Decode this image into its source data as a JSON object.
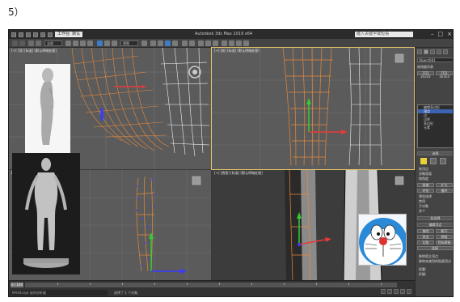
{
  "step_label": "5）",
  "app": {
    "title": "Autodesk 3ds Max 2019 x64",
    "project_field": "工作台: 默认",
    "search_placeholder": "键入关键字或短语",
    "window_controls": [
      "minimize-icon",
      "maximize-icon",
      "close-icon"
    ]
  },
  "toolbar": {
    "selection_filter": "全部",
    "reference_coord": "视图"
  },
  "viewports": {
    "top_left_label": "[+] [顶] [标准] [默认明暗处理]",
    "top_right_label": "[+] [前] [标准] [默认明暗处理]",
    "bottom_left_label": "[+] [左] [标准] [默认明暗处理]",
    "bottom_right_label": "[+] [透视] [标准] [默认明暗处理]"
  },
  "command_panel": {
    "object_name": "Object001",
    "modifier_list_label": "修改器列表",
    "quick_buttons": [
      "FFD 2x2x2",
      "FFD 3x3x3"
    ],
    "stack_items": [
      "编辑多边形",
      "顶点",
      "边",
      "边界",
      "多边形",
      "元素"
    ],
    "selected_stack_item": "顶点",
    "rollout_selection": "选择",
    "rows": [
      "按顶点",
      "忽略背面",
      "按角度",
      "收缩",
      "扩大",
      "环形",
      "循环",
      "预览选择",
      "禁用",
      "子对象",
      "多个"
    ],
    "soft_selection": "软选择",
    "edit_vertices": "编辑顶点",
    "edit_buttons": [
      "移除",
      "断开",
      "挤出",
      "焊接",
      "切角",
      "目标焊接",
      "连接"
    ],
    "bottom_rows": [
      "移除孤立顶点",
      "移除未使用的贴图顶点",
      "权重:",
      "折缝:"
    ]
  },
  "bottom": {
    "frame": "0 / 100",
    "maxscript": "MAXScript 迷你侦听器",
    "status": "选择了 1 个对象"
  },
  "colors": {
    "mesh_wire_selected": "#e8893a",
    "mesh_wire_default": "#f2f2f2",
    "vertex_blue": "#3a3aff",
    "gizmo_y": "#33cc33",
    "gizmo_x": "#e83a3a",
    "selection_highlight": "#3c64b4",
    "viewport_bg": "#5b5b5b"
  }
}
